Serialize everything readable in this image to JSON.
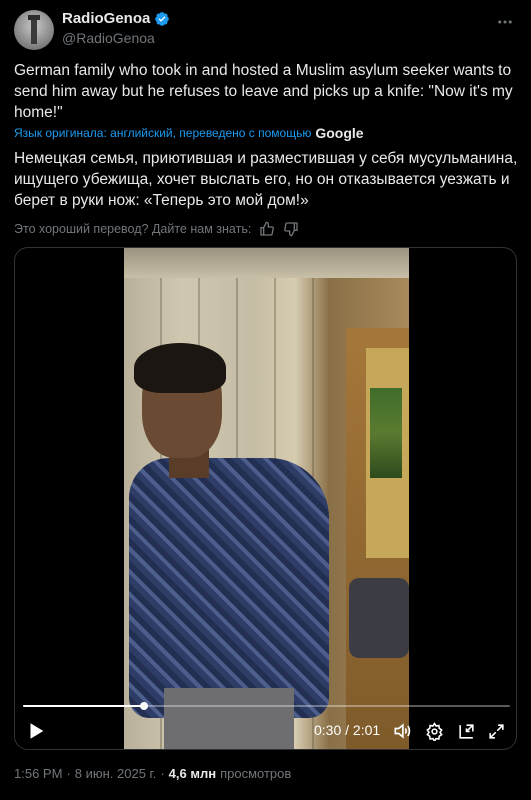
{
  "author": {
    "display_name": "RadioGenoa",
    "handle": "@RadioGenoa",
    "verified": true
  },
  "tweet": {
    "text": "German family who took in and hosted a Muslim asylum seeker wants to send him away but he refuses to leave and picks up a knife: \"Now it's my home!\"",
    "translation_note": "Язык оригинала: английский, переведено с помощью",
    "translation_provider": "Google",
    "translated_text": "Немецкая семья, приютившая и разместившая у себя мусульманина, ищущего убежища, хочет выслать его, но он отказывается уезжать и берет в руки нож: «Теперь это мой дом!»",
    "feedback_prompt": "Это хороший перевод? Дайте нам знать:"
  },
  "video": {
    "current_time": "0:30",
    "duration": "2:01",
    "time_display": "0:30 / 2:01",
    "progress_fraction": 0.248
  },
  "meta": {
    "time": "1:56 PM",
    "separator": "·",
    "date": "8 июн. 2025 г.",
    "views": "4,6 млн",
    "views_label": "просмотров"
  },
  "icons": {
    "verified": "verified-badge-icon",
    "more": "more-icon",
    "thumbs_up": "thumbs-up-icon",
    "thumbs_down": "thumbs-down-icon",
    "play": "play-icon",
    "volume": "volume-icon",
    "settings": "gear-icon",
    "pip": "picture-in-picture-icon",
    "fullscreen": "fullscreen-icon"
  },
  "colors": {
    "background": "#000000",
    "text": "#e7e9ea",
    "secondary": "#71767b",
    "accent": "#1d9bf0"
  }
}
